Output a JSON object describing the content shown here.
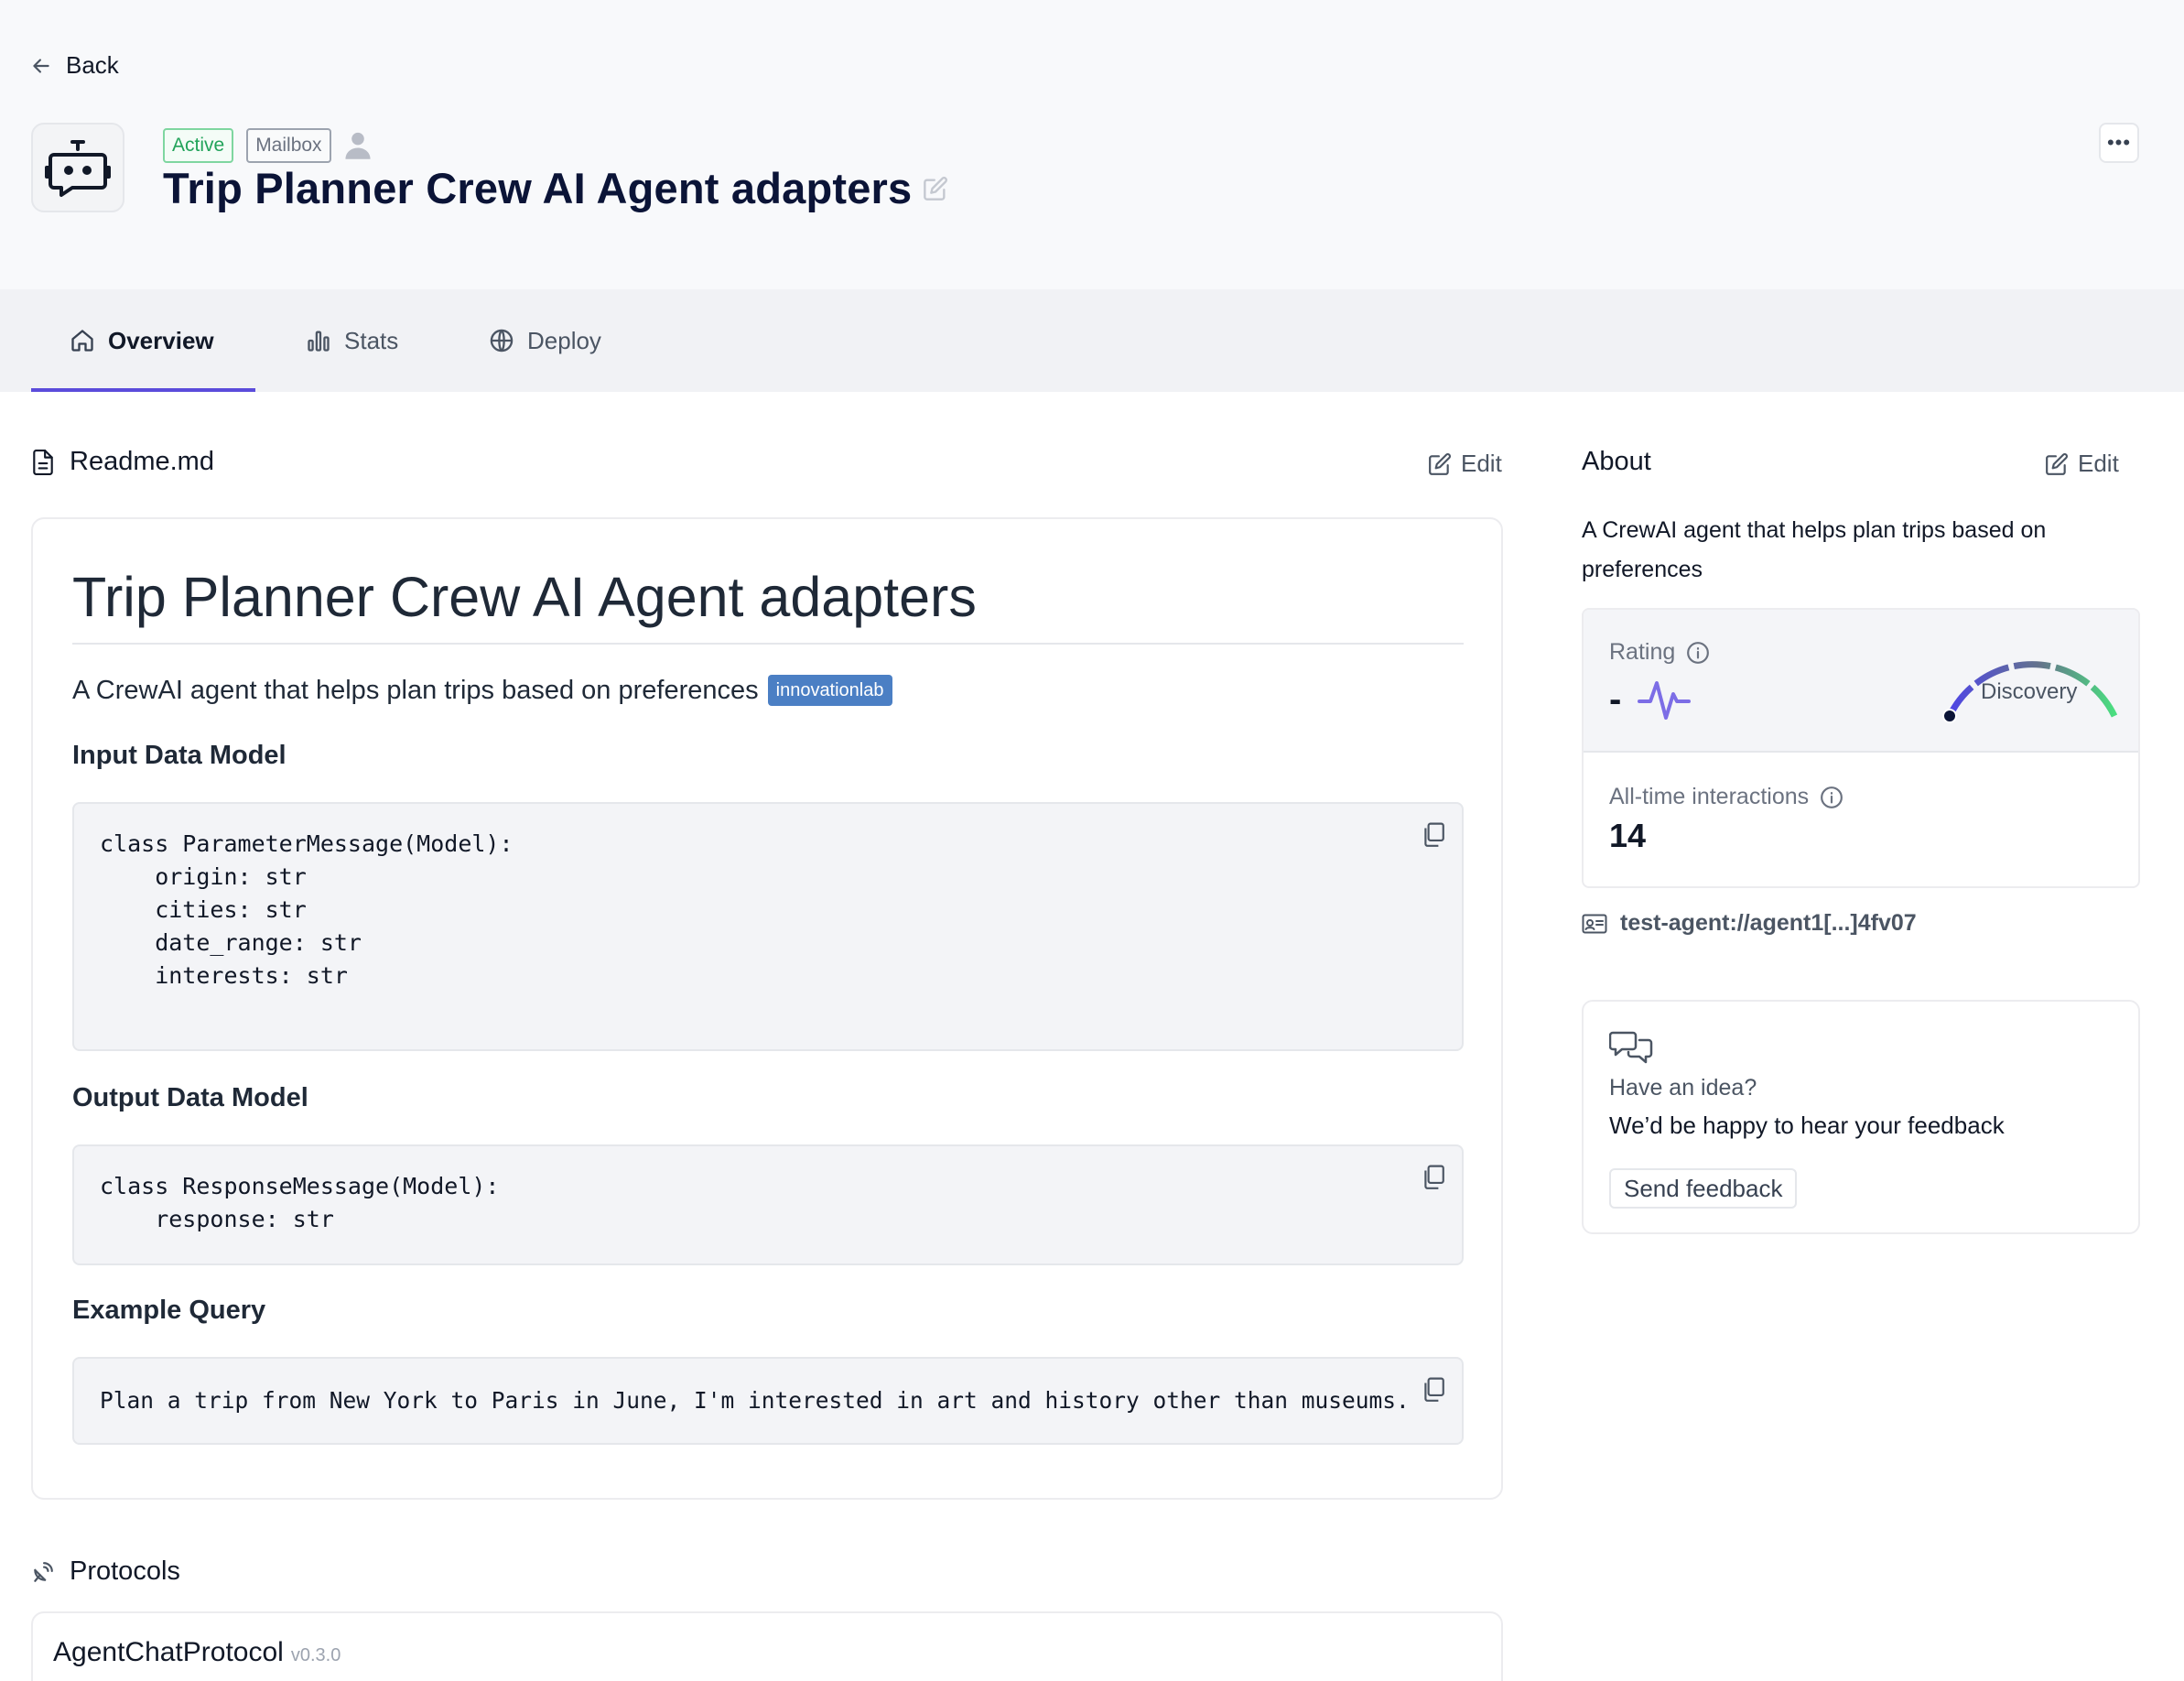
{
  "nav": {
    "back_label": "Back"
  },
  "agent": {
    "badges": {
      "status": "Active",
      "mailbox": "Mailbox"
    },
    "title": "Trip Planner Crew AI Agent adapters",
    "more_label": "•••"
  },
  "tabs": [
    {
      "label": "Overview",
      "icon": "home-icon",
      "selected": true
    },
    {
      "label": "Stats",
      "icon": "bar-chart-icon",
      "selected": false
    },
    {
      "label": "Deploy",
      "icon": "globe-icon",
      "selected": false
    }
  ],
  "readme": {
    "header": "Readme.md",
    "edit_label": "Edit",
    "title": "Trip Planner Crew AI Agent adapters",
    "description": "A CrewAI agent that helps plan trips based on preferences",
    "tag": "innovationlab",
    "input_heading": "Input Data Model",
    "input_code": "class ParameterMessage(Model):\n    origin: str\n    cities: str\n    date_range: str\n    interests: str",
    "output_heading": "Output Data Model",
    "output_code": "class ResponseMessage(Model):\n    response: str",
    "example_heading": "Example Query",
    "example_code": "Plan a trip from New York to Paris in June, I'm interested in art and history other than museums."
  },
  "protocols": {
    "header": "Protocols",
    "items": [
      {
        "name": "AgentChatProtocol",
        "version": "v0.3.0"
      }
    ]
  },
  "about": {
    "header": "About",
    "edit_label": "Edit",
    "description": "A CrewAI agent that helps plan trips based on preferences",
    "rating_label": "Rating",
    "rating_value": "-",
    "gauge_label": "Discovery",
    "interactions_label": "All-time interactions",
    "interactions_value": "14",
    "address": "test-agent://agent1[...]4fv07"
  },
  "feedback": {
    "question": "Have an idea?",
    "subtitle": "We’d be happy to hear your feedback",
    "button_label": "Send feedback"
  },
  "colors": {
    "accent": "#5b4cdb",
    "active_badge": "#22a35a",
    "tag_bg": "#4b7fc4",
    "gauge_start": "#5b4cdb",
    "gauge_end": "#4ade80"
  }
}
